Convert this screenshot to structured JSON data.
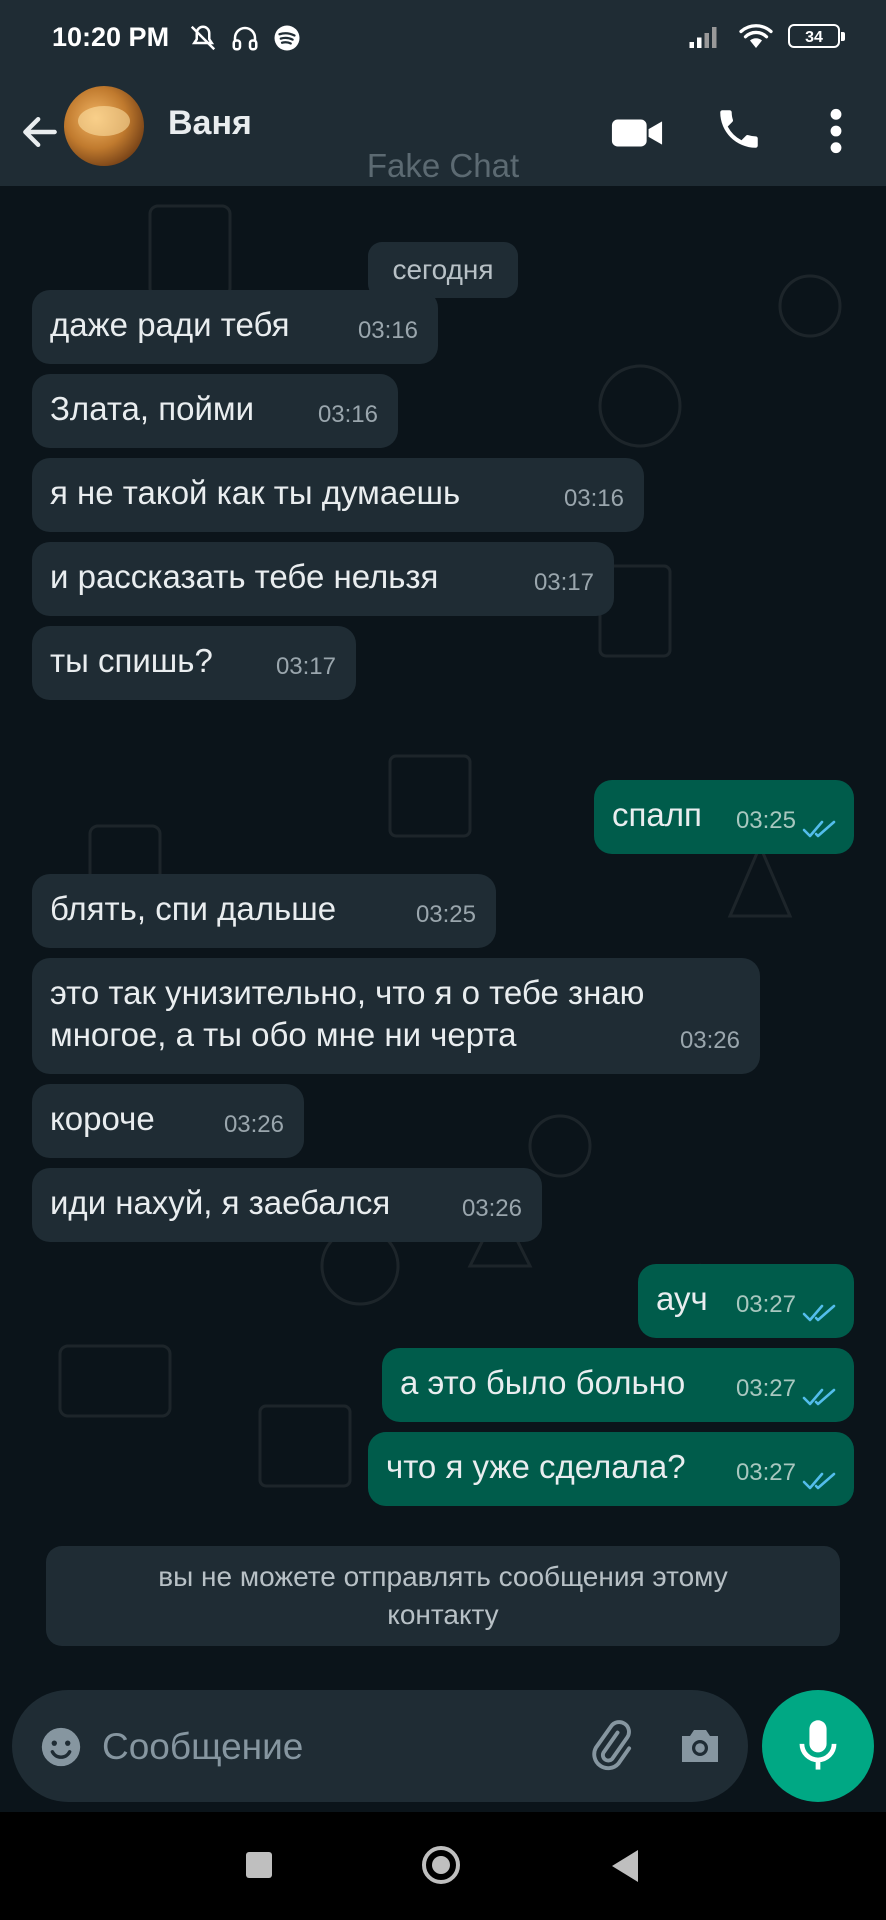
{
  "status_bar": {
    "time": "10:20 PM",
    "left_icons": [
      "muted-bell-icon",
      "headphones-icon",
      "spotify-icon"
    ],
    "right_icons": [
      "signal-icon",
      "wifi-icon"
    ],
    "battery": "34"
  },
  "header": {
    "contact_name": "Ваня",
    "icons": [
      "back-arrow-icon",
      "video-call-icon",
      "phone-call-icon",
      "more-vert-icon"
    ]
  },
  "watermark": "Fake Chat",
  "date_separator": "сегодня",
  "messages": [
    {
      "dir": "in",
      "text": "даже ради тебя",
      "time": "03:16"
    },
    {
      "dir": "in",
      "text": "Злата, пойми",
      "time": "03:16"
    },
    {
      "dir": "in",
      "text": "я не такой как ты думаешь",
      "time": "03:16"
    },
    {
      "dir": "in",
      "text": "и рассказать тебе нельзя",
      "time": "03:17"
    },
    {
      "dir": "in",
      "text": "ты спишь?",
      "time": "03:17"
    },
    {
      "dir": "out",
      "text": "спалп",
      "time": "03:25",
      "read": true
    },
    {
      "dir": "in",
      "text": "блять, спи дальше",
      "time": "03:25"
    },
    {
      "dir": "in",
      "text_line1": "это так унизительно, что я о тебе знаю",
      "text_line2": "многое, а ты обо мне ни черта",
      "time": "03:26"
    },
    {
      "dir": "in",
      "text": "короче",
      "time": "03:26"
    },
    {
      "dir": "in",
      "text": "иди нахуй, я заебался",
      "time": "03:26"
    },
    {
      "dir": "out",
      "text": "ауч",
      "time": "03:27",
      "read": true
    },
    {
      "dir": "out",
      "text": "а это было больно",
      "time": "03:27",
      "read": true
    },
    {
      "dir": "out",
      "text": "что я уже сделала?",
      "time": "03:27",
      "read": true
    }
  ],
  "notice": {
    "line1": "вы не можете отправлять сообщения этому",
    "line2": "контакту"
  },
  "composer": {
    "placeholder": "Сообщение",
    "icons": [
      "emoji-icon",
      "attach-icon",
      "camera-icon",
      "mic-icon"
    ]
  },
  "colors": {
    "background": "#0b141a",
    "header": "#1f2c34",
    "incoming_bubble": "#1f2c34",
    "outgoing_bubble": "#005c4b",
    "accent": "#00a884",
    "read_tick": "#53bdeb"
  }
}
